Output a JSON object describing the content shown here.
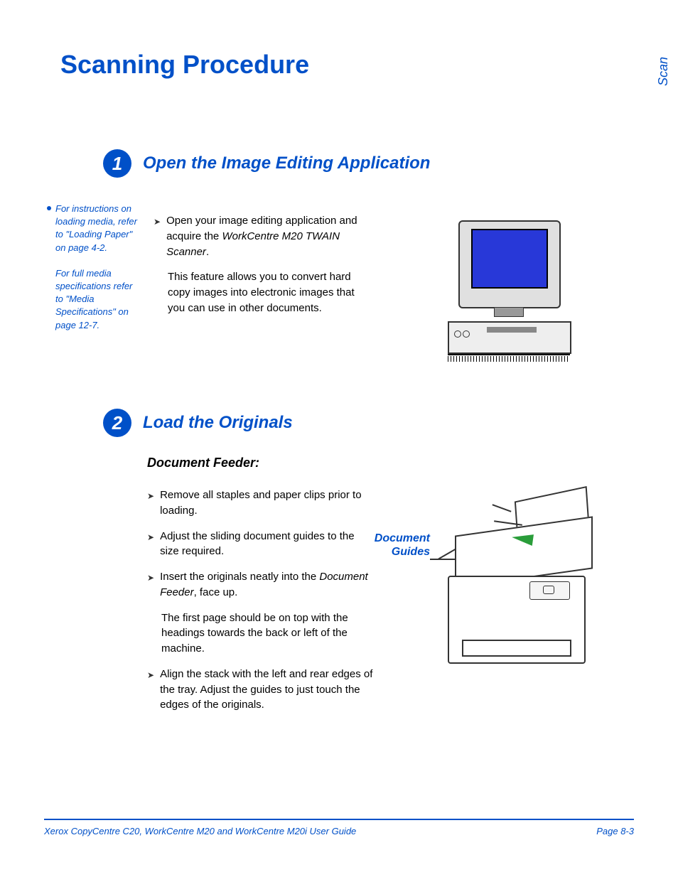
{
  "page_title": "Scanning Procedure",
  "side_tab": "Scan",
  "step1": {
    "number": "1",
    "heading": "Open the Image Editing Application",
    "bullets": [
      {
        "lead": "Open your image editing application and acquire the ",
        "italic": "WorkCentre M20 TWAIN Scanner",
        "trail": "."
      }
    ],
    "paragraph": "This feature allows you to convert hard copy images into electronic images that you can use in other documents."
  },
  "sidebar": {
    "note1": "For instructions on loading media, refer to \"Loading Paper\" on page 4-2.",
    "note2": "For full media specifications refer to \"Media Specifications\" on page 12-7."
  },
  "step2": {
    "number": "2",
    "heading": "Load the Originals",
    "sub_heading": "Document Feeder:",
    "bullets": [
      {
        "text": "Remove all staples and paper clips prior to loading."
      },
      {
        "text": "Adjust the sliding document guides to the size required."
      },
      {
        "lead": "Insert the originals neatly into the ",
        "italic": "Document Feeder",
        "trail": ", face up."
      }
    ],
    "paragraph": "The first page should be on top with the headings towards the back or left of the machine.",
    "bullet4": "Align the stack with the left and rear edges of the tray. Adjust the guides to just touch the edges of the originals.",
    "label": "Document Guides"
  },
  "footer": {
    "left": "Xerox CopyCentre C20, WorkCentre M20 and WorkCentre M20i User Guide",
    "right": "Page 8-3"
  }
}
